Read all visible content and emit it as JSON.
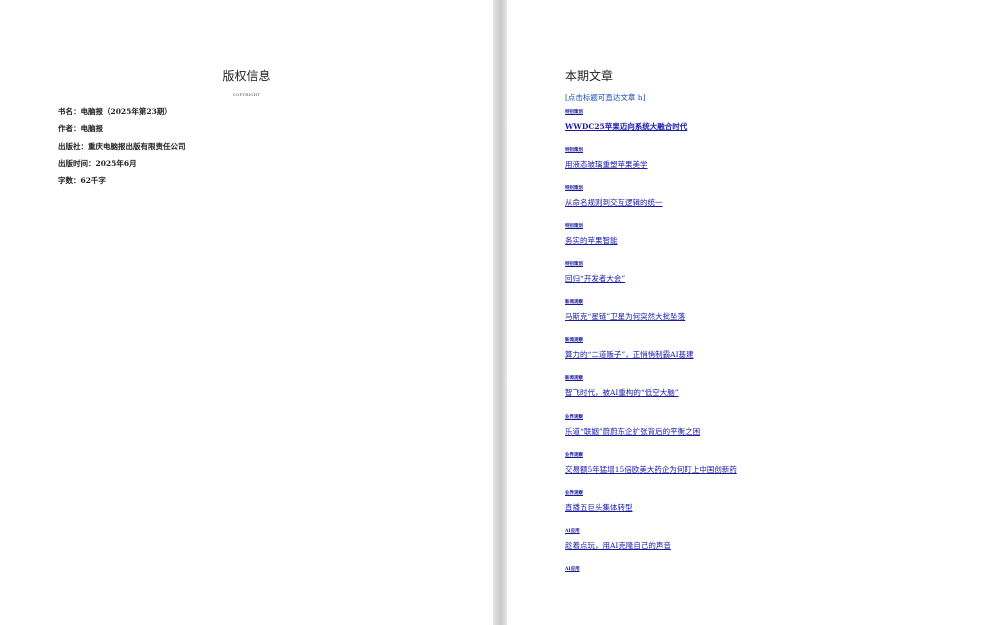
{
  "left_page": {
    "title": "版权信息",
    "subtitle": "COPYRIGHT",
    "meta": [
      "书名：电脑报（2025年第23期）",
      "作者：电脑报",
      "出版社：重庆电脑报出版有限责任公司",
      "出版时间：2025年6月",
      "字数：62千字"
    ]
  },
  "right_page": {
    "title": "本期文章",
    "hint": "[点击标题可直达文章 h]",
    "items": [
      {
        "tag": "特别策划",
        "title": "WWDC25苹果迈向系统大融合时代"
      },
      {
        "tag": "特别策划",
        "title": "用液态玻璃重塑苹果美学"
      },
      {
        "tag": "特别策划",
        "title": "从命名规则到交互逻辑的统一"
      },
      {
        "tag": "特别策划",
        "title": "务实的苹果智能"
      },
      {
        "tag": "特别策划",
        "title": "回归“开发者大会”"
      },
      {
        "tag": "新闻观察",
        "title": "马斯克“星链”卫星为何突然大批坠落"
      },
      {
        "tag": "新闻观察",
        "title": "算力的“二道贩子”，正悄悄制霸AI基建"
      },
      {
        "tag": "新闻观察",
        "title": "智飞时代，被AI重构的“低空大脑”"
      },
      {
        "tag": "业界观察",
        "title": "乐道“联姻”蔚蔚东企扩张背后的平衡之困"
      },
      {
        "tag": "业界观察",
        "title": "交易额5年猛增15倍欧美大药企为何盯上中国创新药"
      },
      {
        "tag": "业界观察",
        "title": "直播五巨头集体转型"
      },
      {
        "tag": "AI应用",
        "title": "趁着点玩，用AI克隆自己的声音"
      },
      {
        "tag": "AI应用",
        "title": ""
      }
    ]
  }
}
